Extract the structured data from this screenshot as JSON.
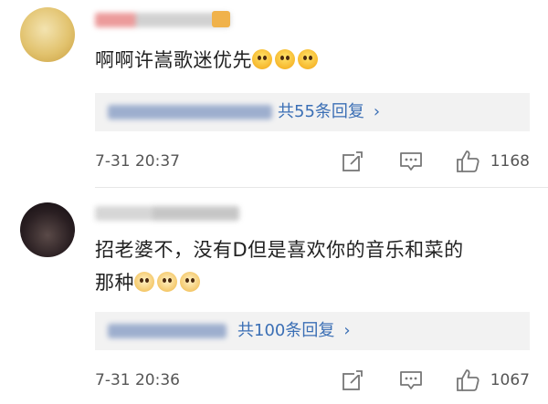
{
  "comments": [
    {
      "text": "啊啊许嵩歌迷优先",
      "reply_label": "共55条回复",
      "time": "7-31 20:37",
      "likes": "1168"
    },
    {
      "text_line1": "招老婆不，没有D但是喜欢你的音乐和菜的",
      "text_line2": "那种",
      "reply_label": "共100条回复",
      "time": "7-31 20:36",
      "likes": "1067"
    }
  ],
  "icons": {
    "chevron": "›",
    "repost": "repost-icon",
    "comment": "comment-icon",
    "like": "thumbs-up-icon"
  },
  "colors": {
    "link": "#3b6fb5",
    "text": "#222222",
    "meta": "#555555",
    "reply_bg": "#f2f2f2"
  }
}
